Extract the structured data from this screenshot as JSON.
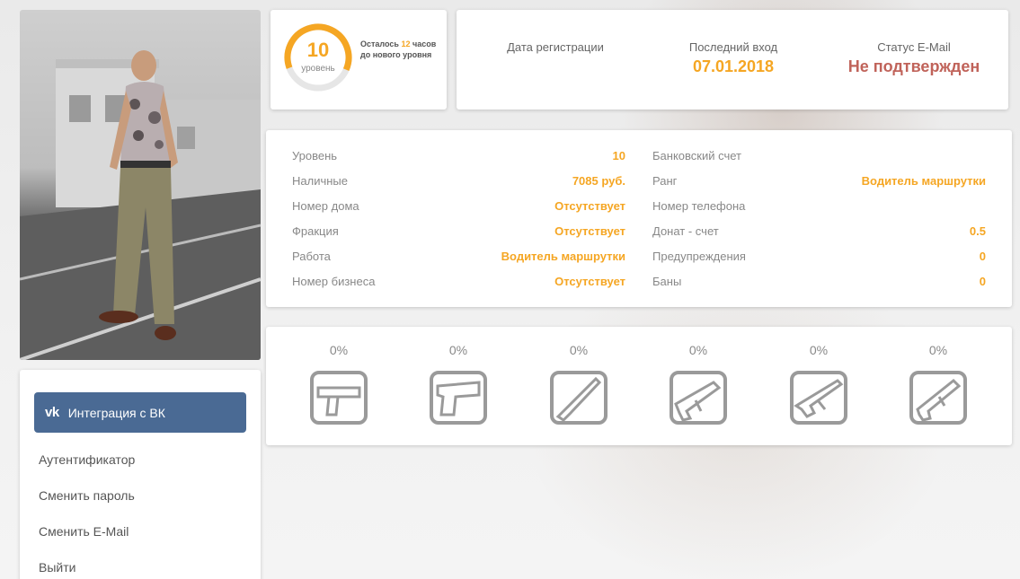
{
  "level": {
    "value": "10",
    "word": "уровень",
    "note_prefix": "Осталось",
    "note_hours": "12",
    "note_suffix": "часов до нового уровня",
    "progress": 0.62,
    "accent": "#f5a623"
  },
  "info": {
    "registration_label": "Дата регистрации",
    "registration_value": "",
    "last_login_label": "Последний вход",
    "last_login_value": "07.01.2018",
    "email_status_label": "Статус E-Mail",
    "email_status_value": "Не подтвержден",
    "email_status_color": "#c0635a"
  },
  "stats": {
    "left": [
      {
        "label": "Уровень",
        "value": "10"
      },
      {
        "label": "Наличные",
        "value": "7085 руб."
      },
      {
        "label": "Номер дома",
        "value": "Отсутствует"
      },
      {
        "label": "Фракция",
        "value": "Отсутствует"
      },
      {
        "label": "Работа",
        "value": "Водитель маршрутки"
      },
      {
        "label": "Номер бизнеса",
        "value": "Отсутствует"
      }
    ],
    "right": [
      {
        "label": "Банковский счет",
        "value": ""
      },
      {
        "label": "Ранг",
        "value": "Водитель маршрутки"
      },
      {
        "label": "Номер телефона",
        "value": ""
      },
      {
        "label": "Донат - счет",
        "value": "0.5"
      },
      {
        "label": "Предупреждения",
        "value": "0"
      },
      {
        "label": "Баны",
        "value": "0"
      }
    ]
  },
  "weapons": [
    {
      "icon": "silenced-pistol-icon",
      "percent": "0%"
    },
    {
      "icon": "desert-eagle-icon",
      "percent": "0%"
    },
    {
      "icon": "shotgun-icon",
      "percent": "0%"
    },
    {
      "icon": "smg-icon",
      "percent": "0%"
    },
    {
      "icon": "ak47-icon",
      "percent": "0%"
    },
    {
      "icon": "m4-rifle-icon",
      "percent": "0%"
    }
  ],
  "menu": {
    "vk_logo": "vk",
    "vk_label": "Интеграция с ВК",
    "items": [
      "Аутентификатор",
      "Сменить пароль",
      "Сменить E-Mail",
      "Выйти"
    ]
  }
}
